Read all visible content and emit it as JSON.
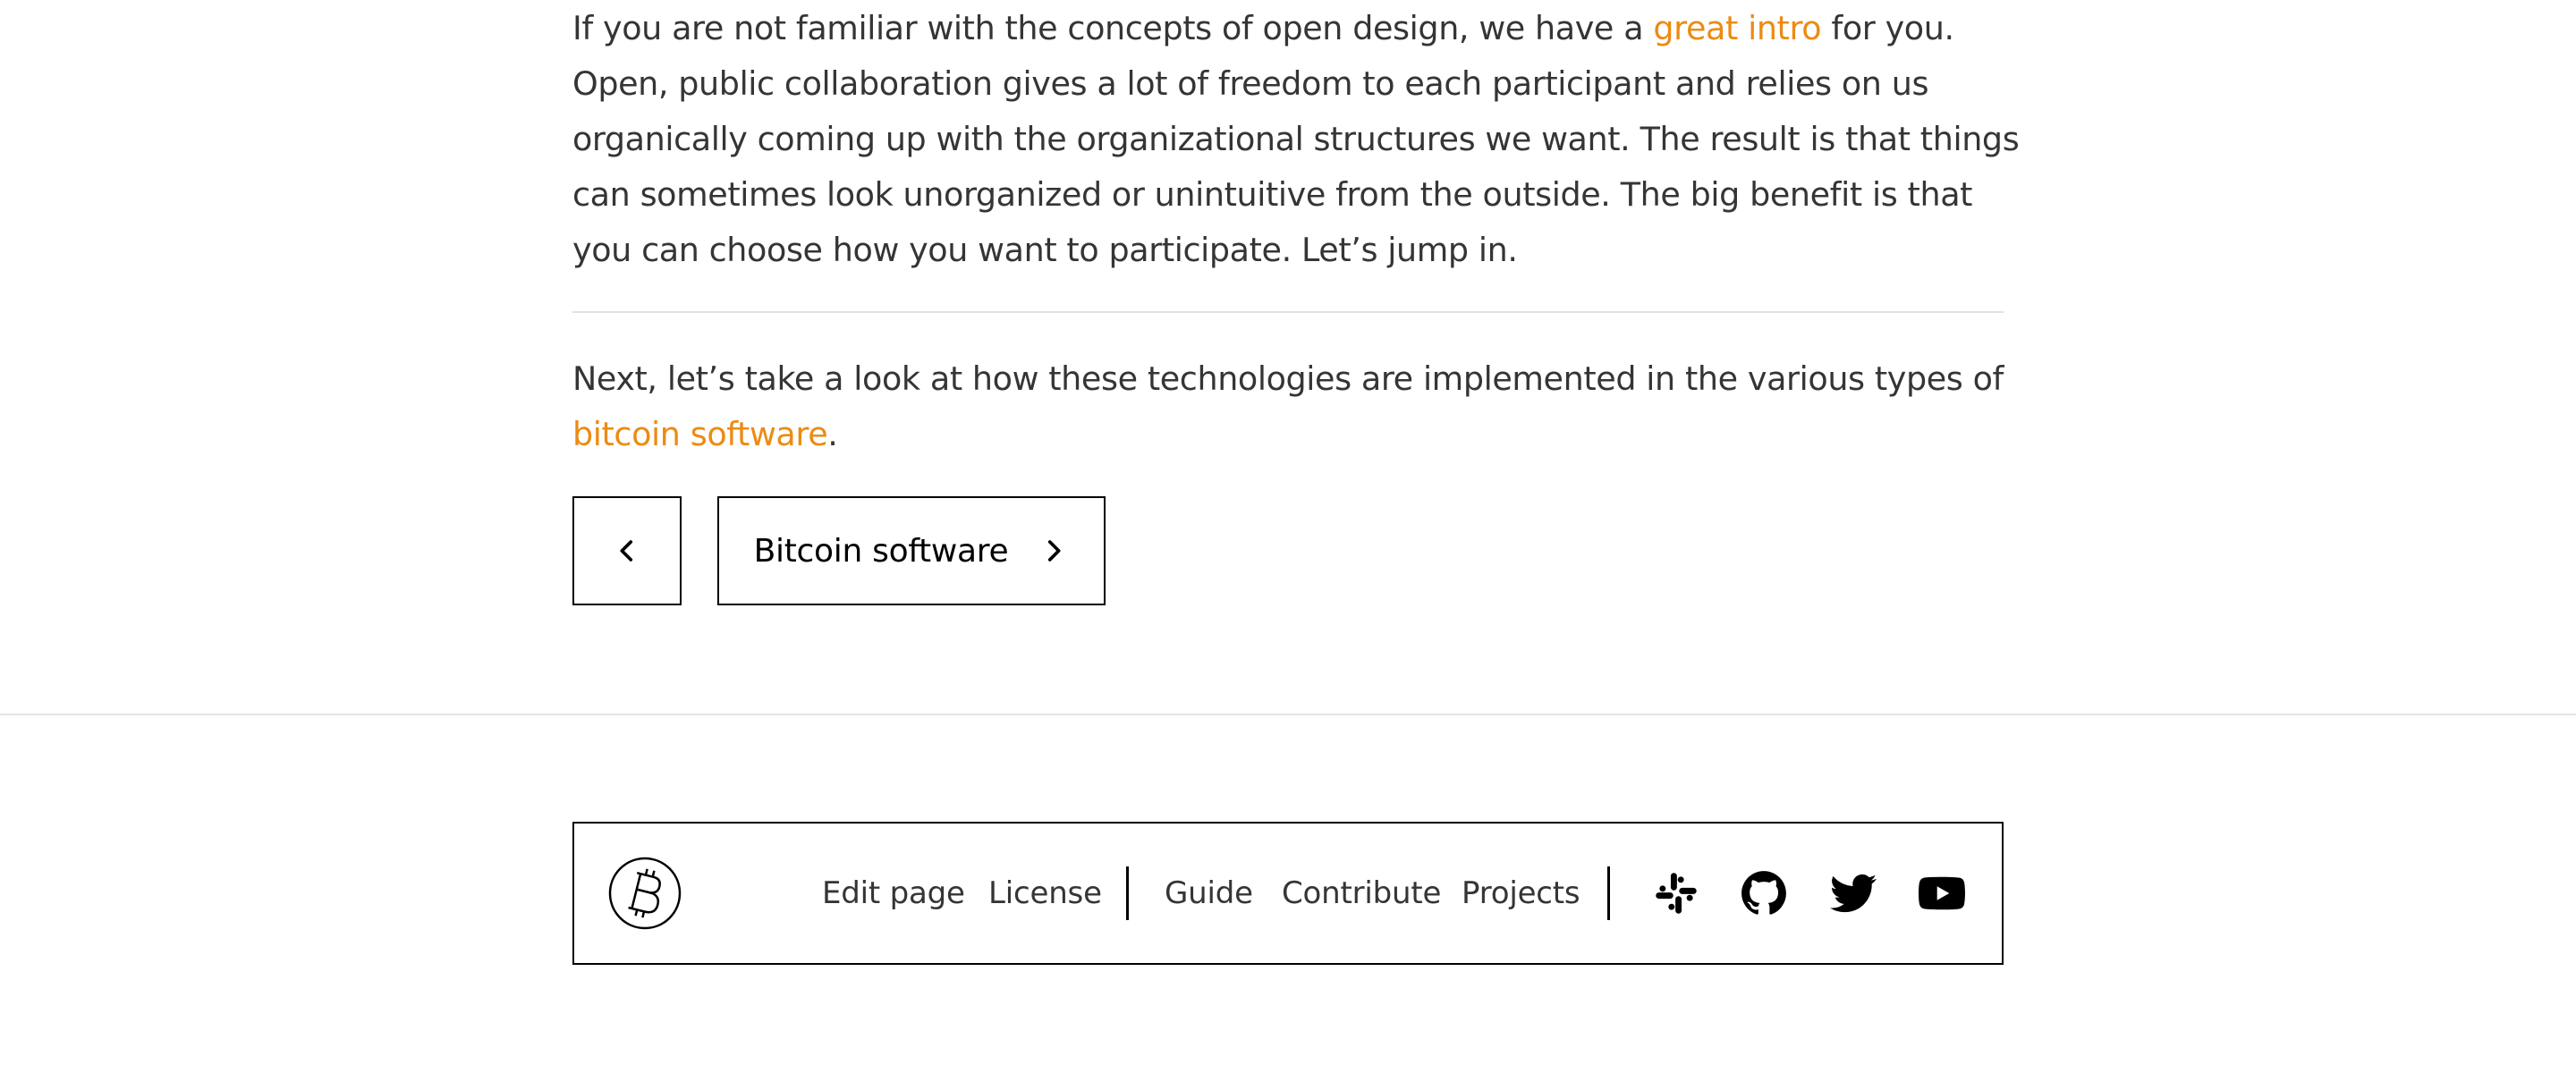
{
  "article": {
    "intro": {
      "text_before": "If you are not familiar with the concepts of open design, we have a ",
      "link_text": "great intro",
      "text_after": " for you. Open, public collaboration gives a lot of freedom to each participant and relies on us organically coming up with the organizational structures we want. The result is that things can sometimes look unorganized or unintuitive from the outside. The big benefit is that you can choose how you want to participate. Let’s jump in."
    },
    "next": {
      "text_before": "Next, let’s take a look at how these technologies are implemented in the various types of ",
      "link_text": "bitcoin software",
      "text_after": "."
    }
  },
  "pagination": {
    "next_label": "Bitcoin software"
  },
  "footer": {
    "links_group1": [
      "Edit page",
      "License"
    ],
    "links_group2": [
      "Guide",
      "Contribute",
      "Projects"
    ],
    "social_icons": [
      "slack-icon",
      "github-icon",
      "twitter-icon",
      "youtube-icon"
    ]
  },
  "colors": {
    "link": "#ec8b12",
    "text": "#353535",
    "border": "#000000"
  }
}
